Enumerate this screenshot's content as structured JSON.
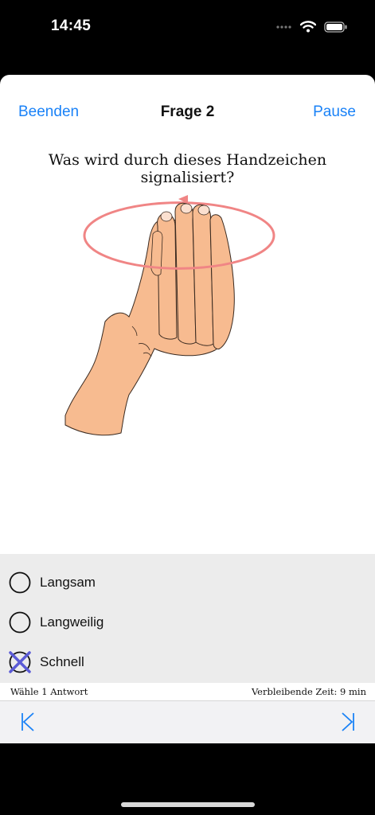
{
  "status": {
    "time": "14:45"
  },
  "nav": {
    "left_label": "Beenden",
    "title": "Frage 2",
    "right_label": "Pause"
  },
  "question": "Was wird durch dieses Handzeichen signalisiert?",
  "illustration": {
    "icon": "hand-signal-circle-icon",
    "ring_color": "#f08585",
    "skin_color": "#f7bb90"
  },
  "answers": [
    {
      "label": "Langsam",
      "selected": false
    },
    {
      "label": "Langweilig",
      "selected": false
    },
    {
      "label": "Schnell",
      "selected": true
    }
  ],
  "info": {
    "instruction": "Wähle 1 Antwort",
    "remaining_time": "Verbleibende Zeit: 9 min"
  },
  "toolbar": {
    "first_icon": "skip-to-first-icon",
    "last_icon": "skip-to-last-icon"
  },
  "colors": {
    "accent": "#1a82f7",
    "selection_mark": "#5b5bd6"
  }
}
